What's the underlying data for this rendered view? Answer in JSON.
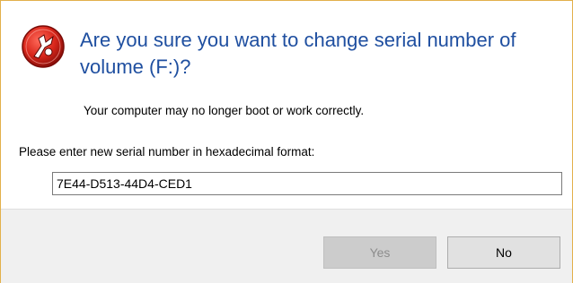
{
  "dialog": {
    "question": "Are you sure you want to change serial number of volume (F:)?",
    "warning": "Your computer may no longer boot or work correctly.",
    "prompt": "Please enter new serial number in hexadecimal format:",
    "serial_value": "7E44-D513-44D4-CED1",
    "icon": "app-tool-icon",
    "title_color": "#1f4fa0"
  },
  "buttons": {
    "yes_label": "Yes",
    "no_label": "No"
  }
}
